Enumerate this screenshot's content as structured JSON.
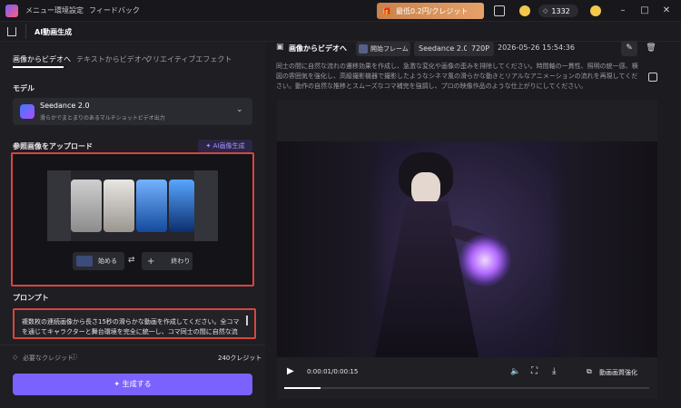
{
  "titlebar": {
    "menu": "メニュー",
    "env": "環境設定",
    "feedback": "フィードバック",
    "promo": "最低0.2円/クレジット",
    "credits": "1332"
  },
  "secondbar": {
    "title": "AI動画生成"
  },
  "left": {
    "tabs": [
      "画像からビデオへ",
      "テキストからビデオへ",
      "クリエイティブエフェクト"
    ],
    "model_label": "モデル",
    "model_name": "Seedance 2.0",
    "model_desc": "滑らかでまとまりのあるマルチショットビデオ出力",
    "ref_label": "参照画像をアップロード",
    "ai_image_btn": "AI画像生成",
    "start_btn": "始める",
    "end_btn": "終わり",
    "prompt_label": "プロンプト",
    "prompt_text": "複数枚の連続画像から長さ15秒の滑らかな動画を作成してください。全コマを通じてキャラクターと舞台環境を完全に統一し、コマ同士の間に自然な流れの遷移効果を作成し、急激な変化や画像の歪みを排除してください。",
    "required_credit_label": "必要なクレジット",
    "credit_value": "240クレジット",
    "generate_btn": "生成する"
  },
  "right": {
    "header_title": "画像からビデオへ",
    "chip_firstframe": "開始フレーム",
    "chip_model": "Seedance 2.0",
    "chip_res": "720P",
    "timestamp": "2026-05-26 15:54:36",
    "desc": "同士の間に自然な流れの遷移効果を作成し、急激な変化や画像の歪みを排除してください。時間軸の一貫性、照明の統一感、横図の雰囲気を強化し、高級撮影機器で撮影したようなシネマ風の滑らかな動きとリアルなアニメーションの流れを再現してください。動作の自然な推移とスムーズなコマ補完を強調し、プロの映像作品のような仕上がりにしてください。",
    "time": "0:00:01/0:00:15",
    "enhance": "動画画質強化",
    "progress": 0.1
  }
}
